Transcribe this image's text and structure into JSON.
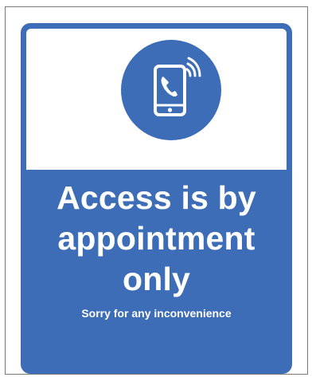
{
  "sign": {
    "icon": "smartphone-calling-icon",
    "line1": "Access is by",
    "line2": "appointment",
    "line3": "only",
    "subtext": "Sorry for any inconvenience"
  },
  "colors": {
    "sign_blue": "#3d6db6",
    "text": "#ffffff",
    "background": "#ffffff"
  }
}
